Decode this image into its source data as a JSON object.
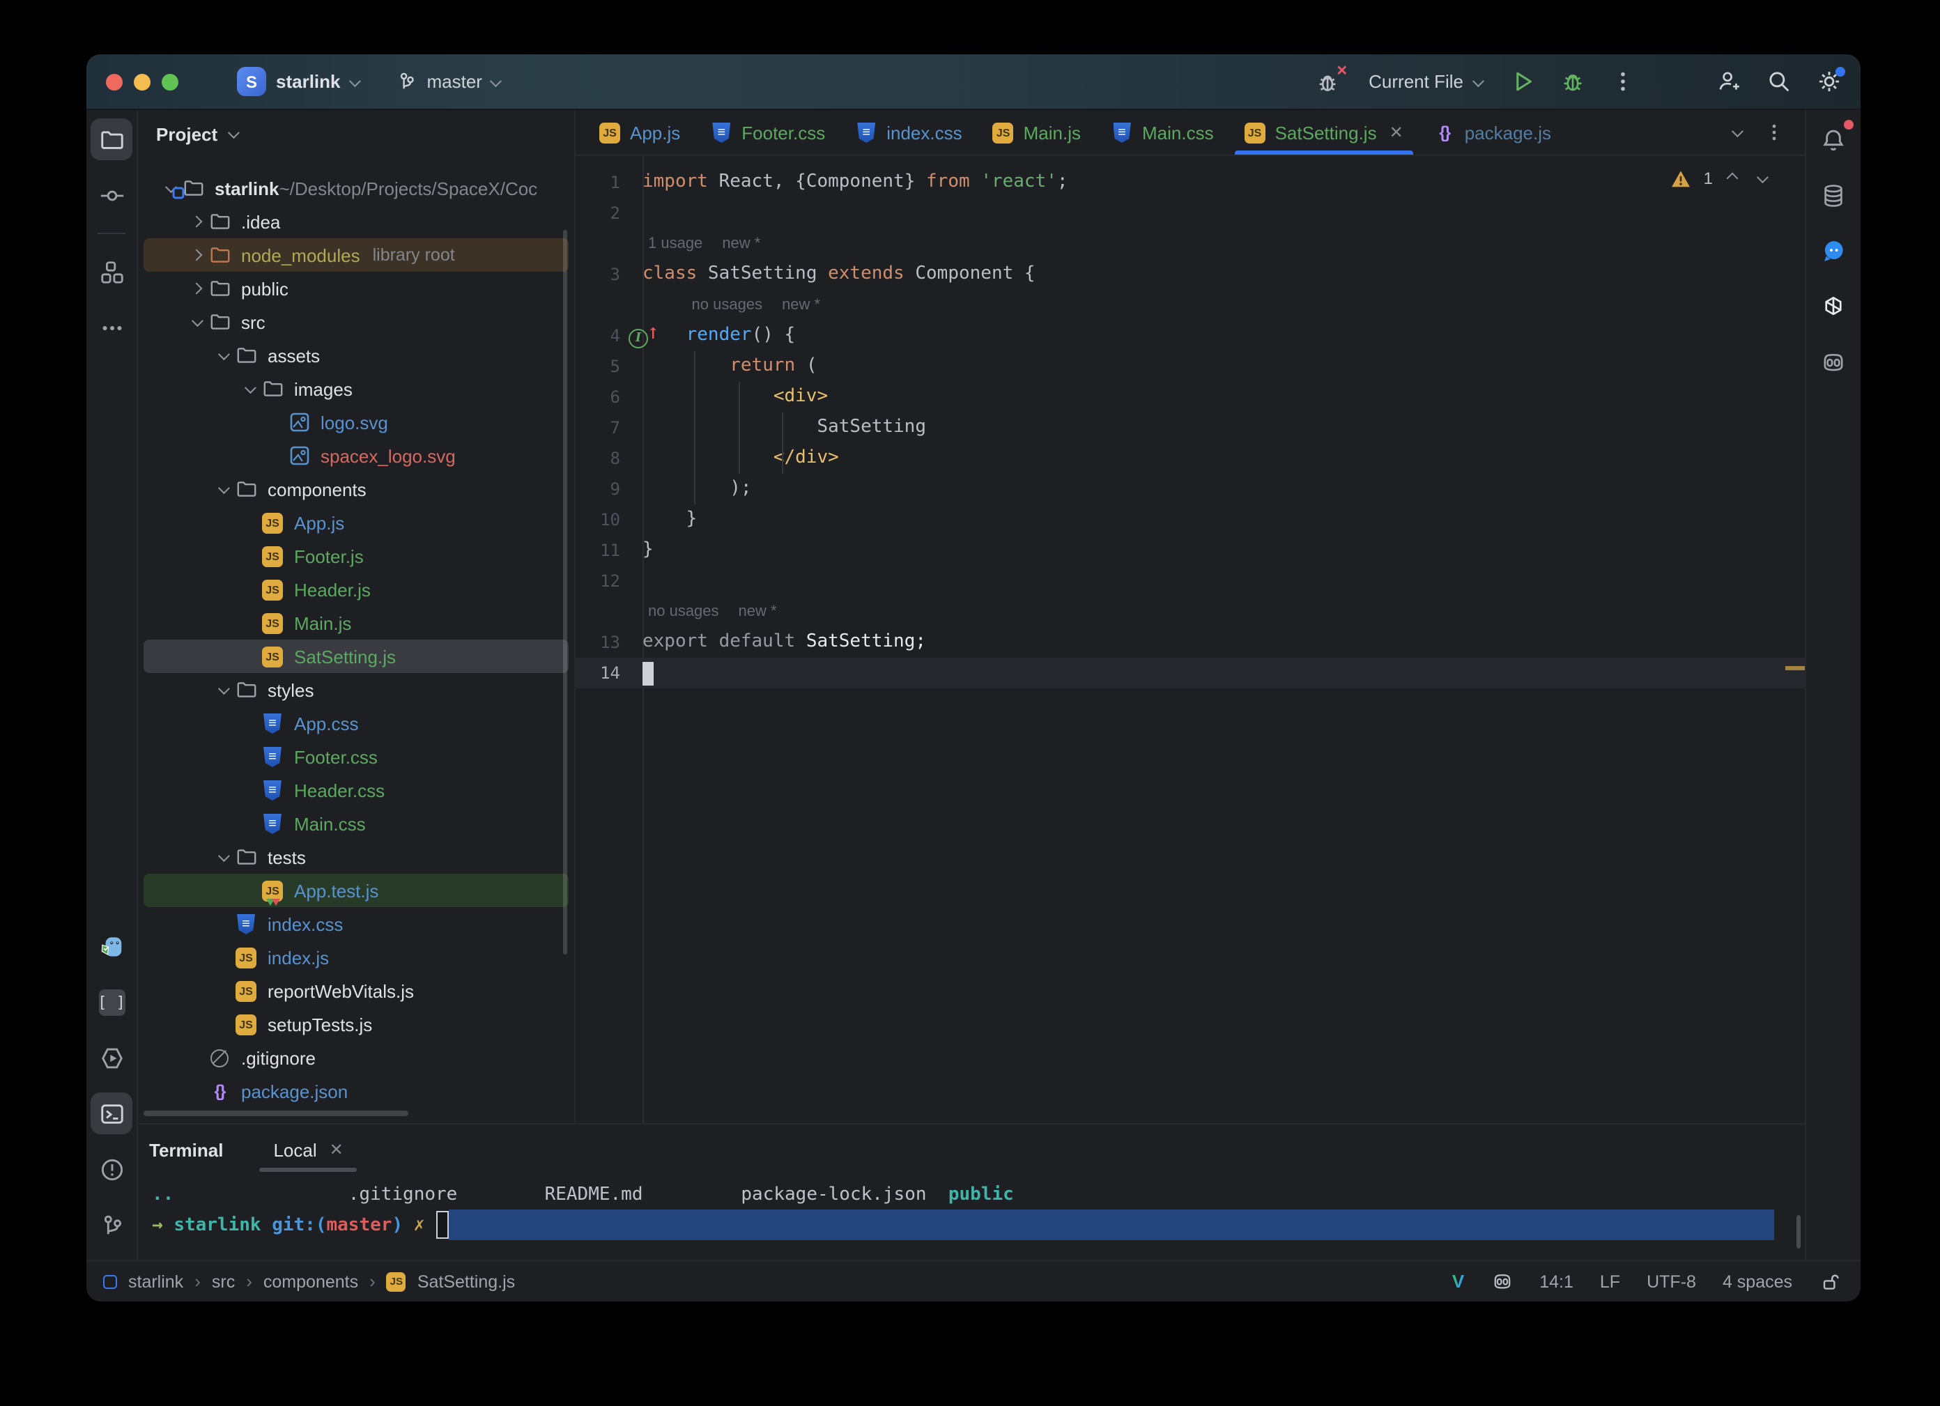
{
  "colors": {
    "bg": "#1e1f22",
    "accent": "#3574f0",
    "titlebar_tint": "#2b3e48",
    "vcs_modified_blue": "#5793d1",
    "vcs_added_green": "#5ca960",
    "vcs_unversioned_red": "#d5695f",
    "vcs_ignored_olive": "#b0aa54",
    "selected_row": "#393b40",
    "current_line": "#26282e",
    "warning_gold": "#d6a243",
    "terminal_selection_blue": "#25457e",
    "traffic_red": "#ee6a5f",
    "traffic_yellow": "#f5bd4f",
    "traffic_green": "#61c354"
  },
  "titlebar": {
    "project": "starlink",
    "branch": "master",
    "run_config": "Current File"
  },
  "left_strip": {
    "top": [
      {
        "icon": "folder-tool",
        "name": "project-tool-icon",
        "active": true
      },
      {
        "icon": "commit",
        "name": "commit-tool-icon"
      },
      {
        "icon": "divider",
        "name": "strip-divider"
      },
      {
        "icon": "structure",
        "name": "structure-tool-icon"
      },
      {
        "icon": "more-h",
        "name": "more-tools-icon"
      }
    ],
    "bottom": [
      {
        "icon": "mascot",
        "name": "plugin-mascot-icon"
      },
      {
        "icon": "brackets",
        "name": "brackets-tool-icon"
      },
      {
        "icon": "services",
        "name": "services-tool-icon"
      },
      {
        "icon": "terminal",
        "name": "terminal-tool-icon",
        "active": true
      },
      {
        "icon": "problems",
        "name": "problems-tool-icon"
      },
      {
        "icon": "git",
        "name": "version-control-tool-icon"
      }
    ]
  },
  "right_strip": [
    {
      "icon": "bell",
      "name": "notifications-bell-icon",
      "badge": true
    },
    {
      "icon": "database",
      "name": "database-tool-icon"
    },
    {
      "icon": "chat",
      "name": "chat-tool-icon"
    },
    {
      "icon": "openai",
      "name": "ai-assistant-icon"
    },
    {
      "icon": "copilot",
      "name": "copilot-tool-icon"
    }
  ],
  "project_panel": {
    "header": "Project",
    "tree": [
      {
        "label": "starlink",
        "path": " ~/Desktop/Projects/SpaceX/Coc",
        "depth": 0,
        "icon": "project-folder",
        "chevron": "down",
        "color": "default",
        "bold": true
      },
      {
        "label": ".idea",
        "depth": 1,
        "icon": "folder",
        "chevron": "right",
        "color": "default"
      },
      {
        "label": "node_modules",
        "suffix": "library root",
        "depth": 1,
        "icon": "folder-excluded",
        "chevron": "right",
        "color": "olive",
        "row": "excluded"
      },
      {
        "label": "public",
        "depth": 1,
        "icon": "folder",
        "chevron": "right",
        "color": "default"
      },
      {
        "label": "src",
        "depth": 1,
        "icon": "folder",
        "chevron": "down",
        "color": "default"
      },
      {
        "label": "assets",
        "depth": 2,
        "icon": "folder",
        "chevron": "down",
        "color": "default"
      },
      {
        "label": "images",
        "depth": 3,
        "icon": "folder",
        "chevron": "down",
        "color": "default"
      },
      {
        "label": "logo.svg",
        "depth": 4,
        "icon": "image",
        "color": "blue"
      },
      {
        "label": "spacex_logo.svg",
        "depth": 4,
        "icon": "image",
        "color": "red"
      },
      {
        "label": "components",
        "depth": 2,
        "icon": "folder",
        "chevron": "down",
        "color": "default"
      },
      {
        "label": "App.js",
        "depth": 3,
        "icon": "js",
        "color": "blue"
      },
      {
        "label": "Footer.js",
        "depth": 3,
        "icon": "js",
        "color": "green"
      },
      {
        "label": "Header.js",
        "depth": 3,
        "icon": "js",
        "color": "green"
      },
      {
        "label": "Main.js",
        "depth": 3,
        "icon": "js",
        "color": "green"
      },
      {
        "label": "SatSetting.js",
        "depth": 3,
        "icon": "js",
        "color": "green",
        "row": "selected"
      },
      {
        "label": "styles",
        "depth": 2,
        "icon": "folder",
        "chevron": "down",
        "color": "default"
      },
      {
        "label": "App.css",
        "depth": 3,
        "icon": "css",
        "color": "blue"
      },
      {
        "label": "Footer.css",
        "depth": 3,
        "icon": "css",
        "color": "green"
      },
      {
        "label": "Header.css",
        "depth": 3,
        "icon": "css",
        "color": "green"
      },
      {
        "label": "Main.css",
        "depth": 3,
        "icon": "css",
        "color": "green"
      },
      {
        "label": "tests",
        "depth": 2,
        "icon": "folder",
        "chevron": "down",
        "color": "default"
      },
      {
        "label": "App.test.js",
        "depth": 3,
        "icon": "js-test",
        "color": "blue",
        "row": "test"
      },
      {
        "label": "index.css",
        "depth": 2,
        "icon": "css",
        "color": "blue"
      },
      {
        "label": "index.js",
        "depth": 2,
        "icon": "js",
        "color": "blue"
      },
      {
        "label": "reportWebVitals.js",
        "depth": 2,
        "icon": "js",
        "color": "default"
      },
      {
        "label": "setupTests.js",
        "depth": 2,
        "icon": "js",
        "color": "default"
      },
      {
        "label": ".gitignore",
        "depth": 1,
        "icon": "ignore",
        "color": "default"
      },
      {
        "label": "package.json",
        "depth": 1,
        "icon": "braces",
        "color": "blue"
      }
    ]
  },
  "tabs": [
    {
      "icon": "js",
      "label": "App.js",
      "color": "blue"
    },
    {
      "icon": "css",
      "label": "Footer.css",
      "color": "green"
    },
    {
      "icon": "css",
      "label": "index.css",
      "color": "blue"
    },
    {
      "icon": "js",
      "label": "Main.js",
      "color": "green"
    },
    {
      "icon": "css",
      "label": "Main.css",
      "color": "green"
    },
    {
      "icon": "js",
      "label": "SatSetting.js",
      "color": "green",
      "active": true,
      "close": true
    },
    {
      "icon": "braces",
      "label": "package.js",
      "color": "dimblue"
    }
  ],
  "editor": {
    "warning_count": "1",
    "rows": [
      {
        "num": "1",
        "segs": [
          {
            "t": "import",
            "c": "k"
          },
          {
            "t": " React, {Component} ",
            "c": "p"
          },
          {
            "t": "from",
            "c": "k"
          },
          {
            "t": " ",
            "c": "p"
          },
          {
            "t": "'react'",
            "c": "s"
          },
          {
            "t": ";",
            "c": "p"
          }
        ]
      },
      {
        "num": "2",
        "segs": []
      },
      {
        "inlay": [
          "1 usage",
          "new *"
        ],
        "indent": 0
      },
      {
        "num": "3",
        "segs": [
          {
            "t": "class",
            "c": "k"
          },
          {
            "t": " SatSetting ",
            "c": "p"
          },
          {
            "t": "extends",
            "c": "k"
          },
          {
            "t": " Component {",
            "c": "p"
          }
        ]
      },
      {
        "inlay": [
          "no usages",
          "new *"
        ],
        "indent": 4
      },
      {
        "num": "4",
        "gutter": "override",
        "segs": [
          {
            "t": "    ",
            "c": "p"
          },
          {
            "t": "render",
            "c": "f"
          },
          {
            "t": "() {",
            "c": "p"
          }
        ]
      },
      {
        "num": "5",
        "segs": [
          {
            "t": "        ",
            "c": "p"
          },
          {
            "t": "return",
            "c": "k"
          },
          {
            "t": " (",
            "c": "p"
          }
        ]
      },
      {
        "num": "6",
        "segs": [
          {
            "t": "            ",
            "c": "p"
          },
          {
            "t": "<div>",
            "c": "t"
          }
        ]
      },
      {
        "num": "7",
        "segs": [
          {
            "t": "                SatSetting",
            "c": "p"
          }
        ]
      },
      {
        "num": "8",
        "segs": [
          {
            "t": "            ",
            "c": "p"
          },
          {
            "t": "</div>",
            "c": "t"
          }
        ]
      },
      {
        "num": "9",
        "segs": [
          {
            "t": "        );",
            "c": "p"
          }
        ]
      },
      {
        "num": "10",
        "segs": [
          {
            "t": "    }",
            "c": "p"
          }
        ]
      },
      {
        "num": "11",
        "segs": [
          {
            "t": "}",
            "c": "p"
          }
        ]
      },
      {
        "num": "12",
        "segs": []
      },
      {
        "inlay": [
          "no usages",
          "new *"
        ],
        "indent": 0
      },
      {
        "num": "13",
        "segs": [
          {
            "t": "export default ",
            "c": "kd"
          },
          {
            "t": "SatSetting;",
            "c": "w"
          }
        ]
      },
      {
        "num": "14",
        "segs": [],
        "current": true,
        "cursor": true
      }
    ]
  },
  "terminal": {
    "title": "Terminal",
    "tab": "Local",
    "listing": [
      {
        "t": "..",
        "c": "t-cyan"
      },
      {
        "t": "                ",
        "c": "t-gray"
      },
      {
        "t": ".gitignore",
        "c": "t-gray"
      },
      {
        "t": "        ",
        "c": "t-gray"
      },
      {
        "t": "README.md",
        "c": "t-gray"
      },
      {
        "t": "         ",
        "c": "t-gray"
      },
      {
        "t": "package-lock.json",
        "c": "t-gray"
      },
      {
        "t": "  ",
        "c": "t-gray"
      },
      {
        "t": "public",
        "c": "t-cyan"
      }
    ],
    "prompt": [
      {
        "t": "→",
        "c": "t-green"
      },
      {
        "t": " ",
        "c": "t-gray"
      },
      {
        "t": "starlink",
        "c": "t-cyan"
      },
      {
        "t": " ",
        "c": "t-gray"
      },
      {
        "t": "git:(",
        "c": "t-blue"
      },
      {
        "t": "master",
        "c": "t-red"
      },
      {
        "t": ") ",
        "c": "t-blue"
      },
      {
        "t": "✗",
        "c": "t-yellow"
      },
      {
        "t": " ",
        "c": "t-gray"
      }
    ]
  },
  "status_bar": {
    "breadcrumbs": [
      "starlink",
      "src",
      "components"
    ],
    "breadcrumb_file": "SatSetting.js",
    "caret": "14:1",
    "line_sep": "LF",
    "encoding": "UTF-8",
    "indent": "4 spaces"
  }
}
